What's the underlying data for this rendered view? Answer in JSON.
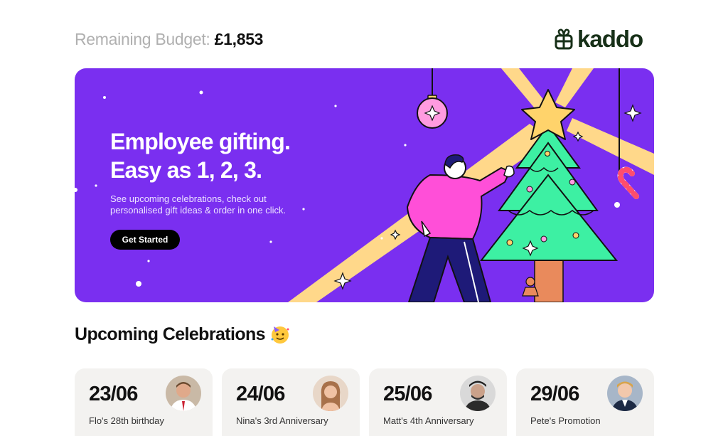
{
  "header": {
    "budget_label": "Remaining Budget:",
    "budget_value": "£1,853",
    "brand_name": "kaddo",
    "brand_color": "#173018"
  },
  "hero": {
    "title_line1": "Employee gifting.",
    "title_line2": "Easy as 1, 2, 3.",
    "subtitle_line1": "See upcoming celebrations, check out",
    "subtitle_line2": "personalised gift ideas & order in one click.",
    "cta_label": "Get Started",
    "bg_color": "#7a2ff0",
    "illustration": "christmas-tree-icon"
  },
  "celebrations": {
    "title": "Upcoming Celebrations",
    "title_icon": "party-face-icon",
    "cards": [
      {
        "date": "23/06",
        "description": "Flo's 28th birthday",
        "avatar": "person-avatar-icon"
      },
      {
        "date": "24/06",
        "description": "Nina's 3rd Anniversary",
        "avatar": "person-avatar-icon"
      },
      {
        "date": "25/06",
        "description": "Matt's 4th Anniversary",
        "avatar": "person-avatar-icon"
      },
      {
        "date": "29/06",
        "description": "Pete's Promotion",
        "avatar": "person-avatar-icon"
      }
    ]
  }
}
